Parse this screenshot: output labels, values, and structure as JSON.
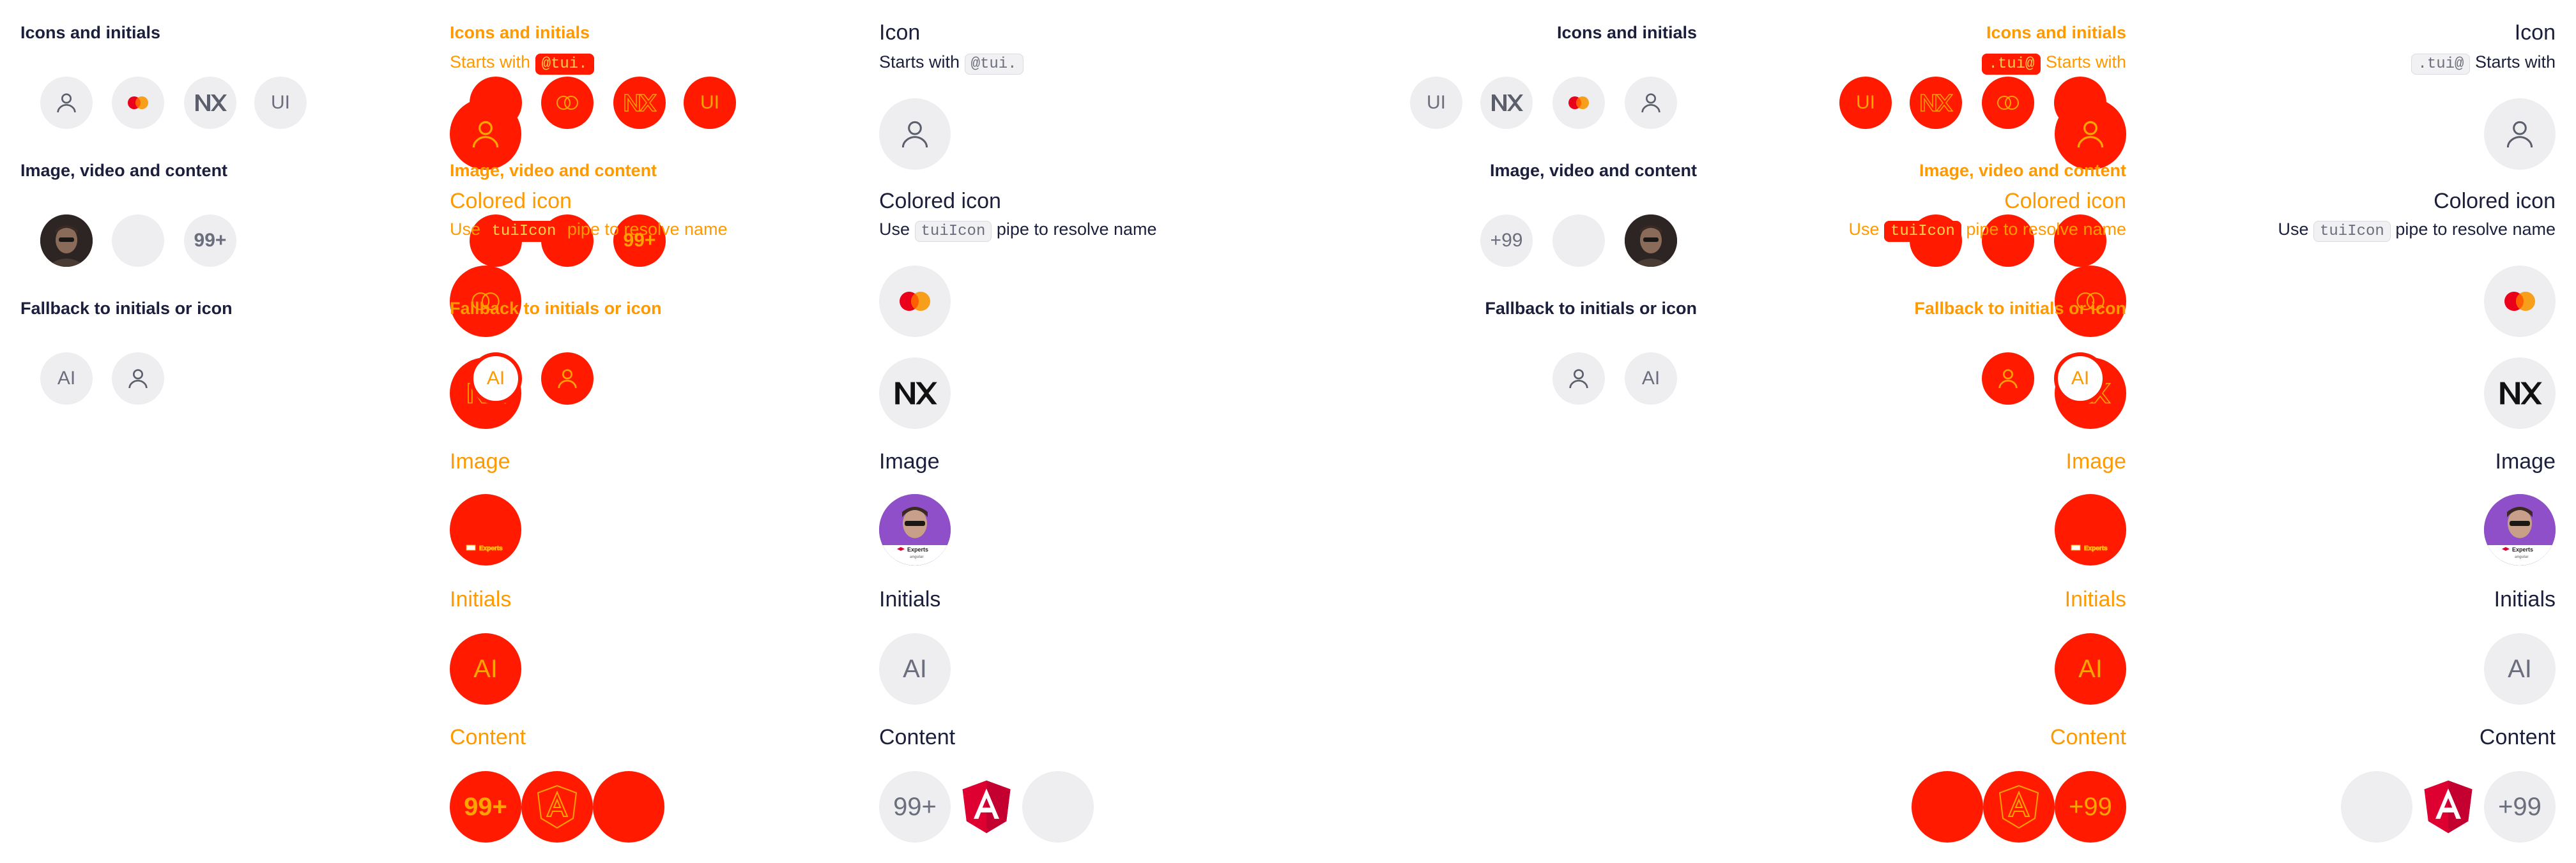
{
  "small": {
    "icons_title": "Icons and initials",
    "image_title": "Image, video and content",
    "fallback_title": "Fallback to initials or icon",
    "initials_ui": "UI",
    "initials_ai": "AI",
    "count": "99+",
    "count_rtl": "+99"
  },
  "big": {
    "icon_title": "Icon",
    "starts_with": "Starts with",
    "tui_code": "@tui.",
    "tui_code_rtl": ".tui@",
    "colored_title": "Colored icon",
    "use_text": "Use",
    "pipe_code": "tuiIcon",
    "pipe_text": "pipe to resolve name",
    "image_title": "Image",
    "initials_title": "Initials",
    "initials_value": "AI",
    "content_title": "Content",
    "content_count": "99+",
    "content_count_rtl": "+99",
    "badge_logo_text": "Experts",
    "badge_logo_sub": "angular"
  },
  "colors": {
    "overlay_red": "#ff1a00",
    "overlay_orange": "#ff9900",
    "avatar_bg": "#eeeef1",
    "text_main": "#1b1f3b",
    "angular_red": "#dd0031"
  }
}
